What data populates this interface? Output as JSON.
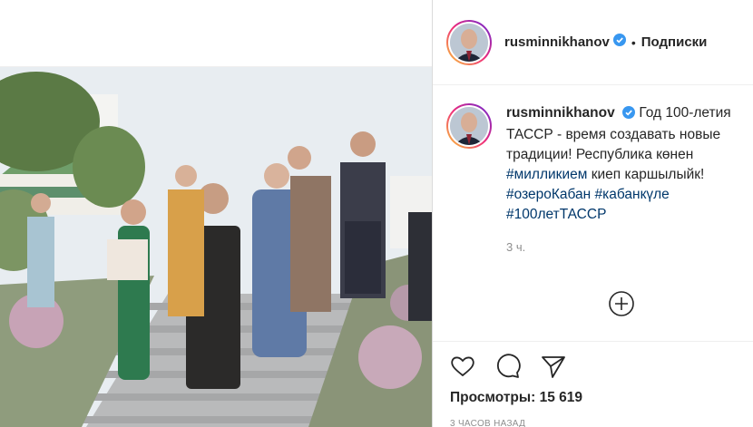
{
  "header": {
    "username": "rusminnikhanov",
    "separator": "•",
    "follow_label": "Подписки"
  },
  "caption": {
    "username": "rusminnikhanov",
    "text": "Год 100-летия ТАССР - время создавать новые традиции! Республика көнен",
    "hashtags": [
      "#милликием",
      "#озероКабан",
      "#кабанкүле",
      "#100летТАССР"
    ],
    "text_after_tag1": "киеп каршылыйк!",
    "time": "3 ч."
  },
  "stats": {
    "views_label": "Просмотры:",
    "views_value": "15 619",
    "posted_ago": "3 ЧАСОВ НАЗАД"
  },
  "colors": {
    "link": "#00376b",
    "verified": "#3897f0",
    "muted": "#8e8e8e"
  },
  "icons": {
    "verified": "verified-badge-icon",
    "add_comment": "plus-circle-icon",
    "like": "heart-icon",
    "comment": "comment-icon",
    "share": "paper-plane-icon"
  }
}
